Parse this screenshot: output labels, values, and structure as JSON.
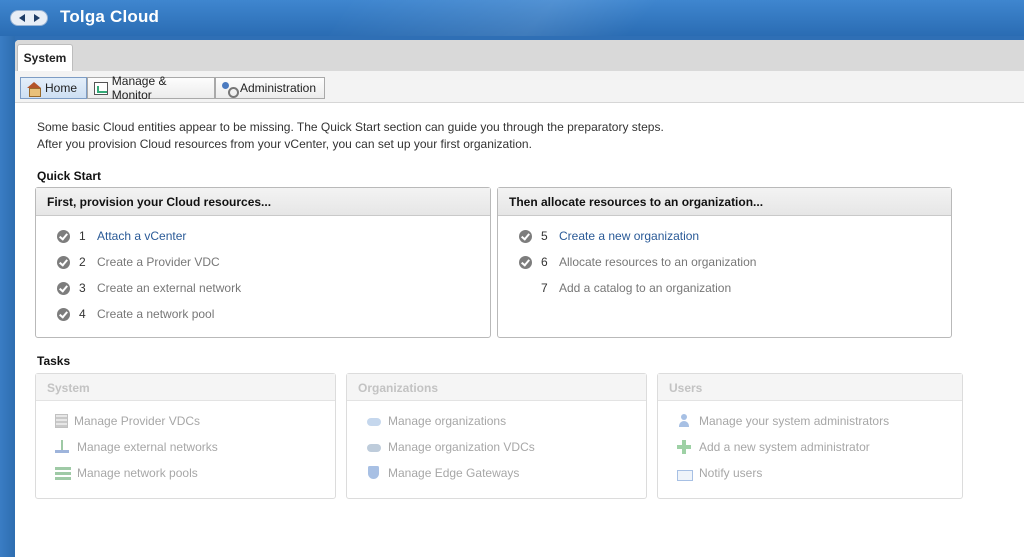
{
  "app": {
    "title": "Tolga Cloud"
  },
  "tabs": [
    {
      "label": "System"
    }
  ],
  "toolbar": {
    "home_label": "Home",
    "manage_label": "Manage & Monitor",
    "admin_label": "Administration"
  },
  "intro": {
    "line1": "Some basic Cloud entities appear to be missing. The Quick Start section can guide you through the preparatory steps.",
    "line2": "After you provision Cloud resources from your vCenter, you can set up your first organization."
  },
  "quick_start": {
    "title": "Quick Start",
    "left": {
      "heading": "First, provision your Cloud resources...",
      "items": [
        {
          "num": "1",
          "label": "Attach a vCenter",
          "checked": true,
          "link": true
        },
        {
          "num": "2",
          "label": "Create a Provider VDC",
          "checked": true,
          "link": false
        },
        {
          "num": "3",
          "label": "Create an external network",
          "checked": true,
          "link": false
        },
        {
          "num": "4",
          "label": "Create a network pool",
          "checked": true,
          "link": false
        }
      ]
    },
    "right": {
      "heading": "Then allocate resources to an organization...",
      "items": [
        {
          "num": "5",
          "label": "Create a new organization",
          "checked": true,
          "link": true
        },
        {
          "num": "6",
          "label": "Allocate resources to an organization",
          "checked": true,
          "link": false
        },
        {
          "num": "7",
          "label": "Add a catalog to an organization",
          "checked": false,
          "link": false
        }
      ]
    }
  },
  "tasks": {
    "title": "Tasks",
    "system": {
      "heading": "System",
      "items": [
        {
          "label": "Manage Provider VDCs",
          "icon": "provider-vdc-icon"
        },
        {
          "label": "Manage external networks",
          "icon": "external-network-icon"
        },
        {
          "label": "Manage network pools",
          "icon": "network-pool-icon"
        }
      ]
    },
    "organizations": {
      "heading": "Organizations",
      "items": [
        {
          "label": "Manage organizations",
          "icon": "cloud-icon"
        },
        {
          "label": "Manage organization VDCs",
          "icon": "org-vdc-cloud-icon"
        },
        {
          "label": "Manage Edge Gateways",
          "icon": "shield-icon"
        }
      ]
    },
    "users": {
      "heading": "Users",
      "items": [
        {
          "label": "Manage your system administrators",
          "icon": "user-icon"
        },
        {
          "label": "Add a new system administrator",
          "icon": "add-icon"
        },
        {
          "label": "Notify users",
          "icon": "mail-icon"
        }
      ]
    }
  },
  "colors": {
    "titlebar": "#2f6fb5",
    "link": "#2a5a97",
    "disabled_text": "#a7a7a7"
  }
}
